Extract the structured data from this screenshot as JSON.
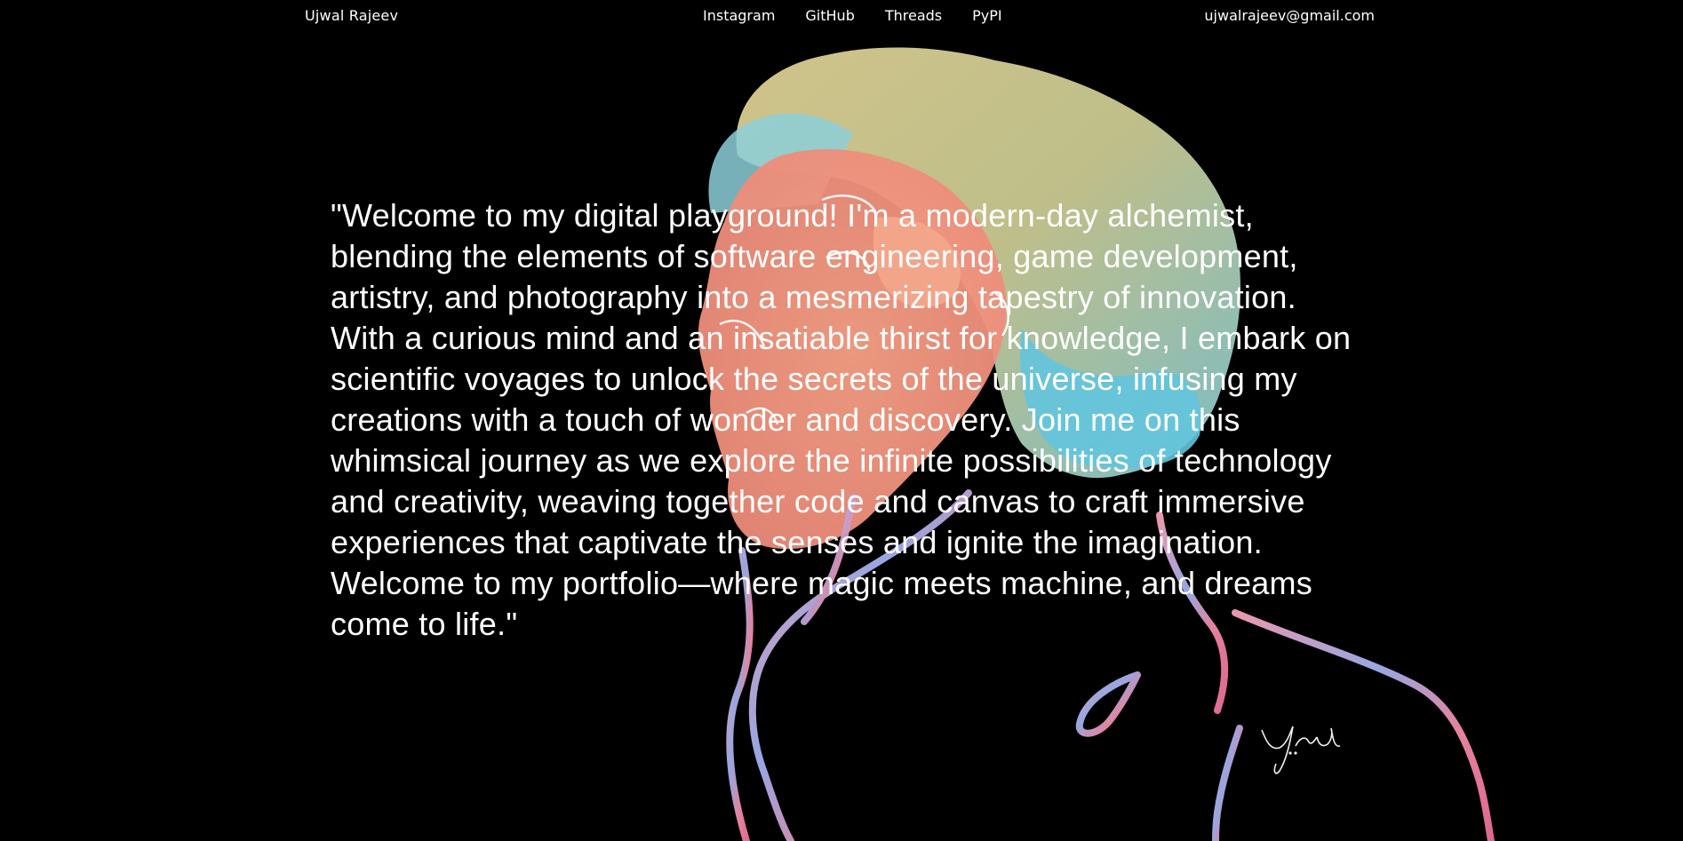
{
  "header": {
    "brand": "Ujwal Rajeev",
    "nav": [
      "Instagram",
      "GitHub",
      "Threads",
      "PyPI"
    ],
    "email": "ujwalrajeev@gmail.com"
  },
  "hero": {
    "intro": "\"Welcome to my digital playground! I'm a modern-day alchemist, blending the elements of software engineering, game development, artistry, and photography into a mesmerizing tapestry of innovation. With a curious mind and an insatiable thirst for knowledge, I embark on scientific voyages to unlock the secrets of the universe, infusing my creations with a touch of wonder and discovery. Join me on this whimsical journey as we explore the infinite possibilities of technology and creativity, weaving together code and canvas to craft immersive experiences that captivate the senses and ignite the imagination. Welcome to my portfolio—where magic meets machine, and dreams come to life.\""
  },
  "artwork": {
    "subject": "watercolor profile portrait",
    "colors": {
      "hair_yellow": "#d8c98c",
      "hair_blue": "#7fcfd8",
      "skin": "#f1937c",
      "line_pink": "#f08aa8",
      "line_blue": "#8fa6e6"
    }
  }
}
